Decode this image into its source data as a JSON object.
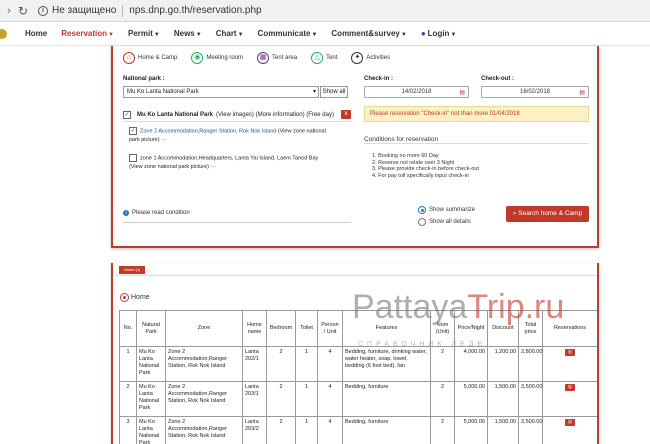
{
  "browser": {
    "security_text": "Не защищено",
    "url": "nps.dnp.go.th/reservation.php"
  },
  "nav": {
    "items": [
      {
        "label": "Home",
        "active": false,
        "dropdown": false
      },
      {
        "label": "Reservation",
        "active": true,
        "dropdown": true
      },
      {
        "label": "Permit",
        "active": false,
        "dropdown": true
      },
      {
        "label": "News",
        "active": false,
        "dropdown": true
      },
      {
        "label": "Chart",
        "active": false,
        "dropdown": true
      },
      {
        "label": "Communicate",
        "active": false,
        "dropdown": true
      },
      {
        "label": "Comment&survey",
        "active": false,
        "dropdown": true
      },
      {
        "label": "Login",
        "active": false,
        "dropdown": true
      }
    ]
  },
  "search": {
    "types": [
      {
        "label": "Home & Camp",
        "icon": "home-camp-icon"
      },
      {
        "label": "Meeting room",
        "icon": "meeting-room-icon"
      },
      {
        "label": "Tent area",
        "icon": "tent-area-icon"
      },
      {
        "label": "Tent",
        "icon": "tent-icon"
      },
      {
        "label": "Activities",
        "icon": "activities-icon"
      }
    ],
    "national_park_label": "National park :",
    "national_park_value": "Mu Ko Lanta National Park",
    "show_all": "Show all",
    "checkin_label": "Check-in :",
    "checkin_value": "14/02/2018",
    "checkout_label": "Check-out :",
    "checkout_value": "16/02/2018",
    "warning": "Please reservation \"Check-in\" not than more 01/04/2018",
    "park_name": "Mu Ko Lanta National Park",
    "park_info": "(View images) (More information) (Free day)",
    "remove": "x",
    "zone1": {
      "text": "Zone 2 Accommodation,Ranger Station, Rok Nok Island",
      "link": "(View zone national",
      "link2": "park picture)",
      "more": "···",
      "checked": true
    },
    "zone2": {
      "text": "zone 1 Accommodation,Headquarters, Lanta Yai Island, Laem Tanod Bay",
      "link": "(View zone national park picture)",
      "more": "···",
      "checked": false
    },
    "conditions_title": "Conditions for reservation",
    "conditions": [
      "1. Booking no more 60 Day",
      "2. Reserve not relate over 3 Night",
      "3. Please provide check-in before check-out",
      "4. For pay toll specifically input check-in"
    ],
    "read_condition": "Please read condition",
    "radio_summarize": "Show summarize",
    "radio_all": "Show all details",
    "search_button": "Search home & Camp"
  },
  "results": {
    "tag": "Home (x)",
    "home_tab": "Home",
    "columns": [
      "No.",
      "Natural Park",
      "Zone",
      "Home name",
      "Bedroom",
      "Toilet",
      "Person / Unit",
      "Features",
      "Num (Unit)",
      "Price/Night",
      "Discount",
      "Total price",
      "Reservations"
    ],
    "rows": [
      {
        "no": "1",
        "park": "Mu Ko Lanta National Park",
        "zone": "Zone 2 Accommodation,Ranger Station, Rok Nok Island",
        "home": "Lanta 202/1",
        "bedroom": "2",
        "toilet": "1",
        "person": "4",
        "features": "Bedding, furniture, drinking water, water heater, soap, towel, bedding (6 foot bed), fan",
        "num": "2",
        "price": "4,000.00",
        "discount": "1,200.00",
        "total": "2,800.00"
      },
      {
        "no": "2",
        "park": "Mu Ko Lanta National Park",
        "zone": "Zone 2 Accommodation,Ranger Station, Rok Nok Island",
        "home": "Lanta 203/1",
        "bedroom": "2",
        "toilet": "1",
        "person": "4",
        "features": "Bedding, furniture",
        "num": "2",
        "price": "5,000.00",
        "discount": "1,500.00",
        "total": "3,500.00"
      },
      {
        "no": "3",
        "park": "Mu Ko Lanta National Park",
        "zone": "Zone 2 Accommodation,Ranger Station, Rok Nok Island",
        "home": "Lanta 203/2",
        "bedroom": "2",
        "toilet": "1",
        "person": "4",
        "features": "Bedding, furniture",
        "num": "2",
        "price": "5,000.00",
        "discount": "1,500.00",
        "total": "3,500.00"
      }
    ],
    "book_label": "◎"
  },
  "watermark": {
    "part1": "Pattaya",
    "part2": "Trip.ru",
    "sub": "СПРАВОЧНИК ЛЕДЕ"
  }
}
